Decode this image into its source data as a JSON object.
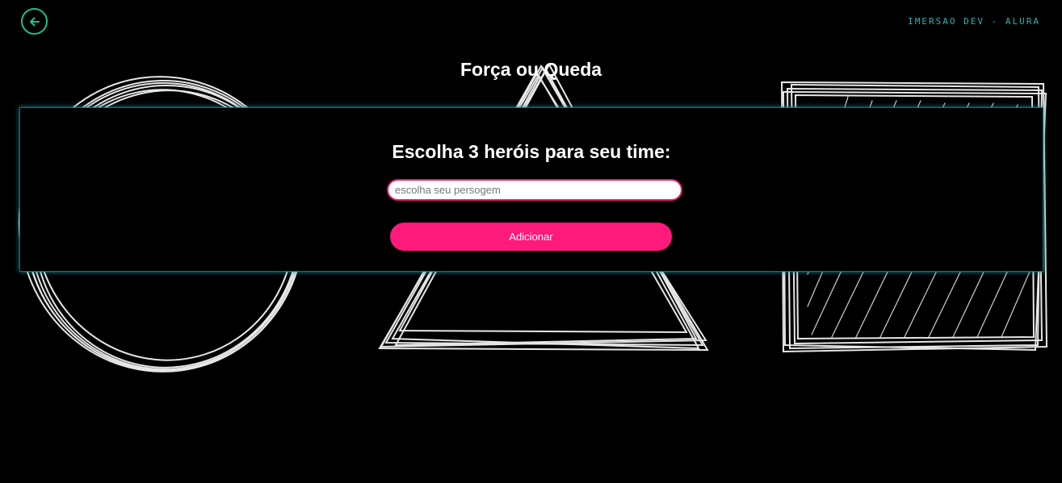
{
  "header": {
    "back_icon": "arrow-left-icon",
    "brand": "imersao dev - alura",
    "accent_color": "#1fbf8f",
    "brand_color": "#2bb3b1"
  },
  "page": {
    "title": "Força ou Queda"
  },
  "form": {
    "heading": "Escolha 3 heróis para seu time:",
    "input_placeholder": "escolha seu persogem",
    "input_value": "",
    "add_label": "Adicionar",
    "button_color": "#fe1a7a"
  },
  "background": {
    "shapes": [
      "circle",
      "triangle",
      "square"
    ]
  }
}
